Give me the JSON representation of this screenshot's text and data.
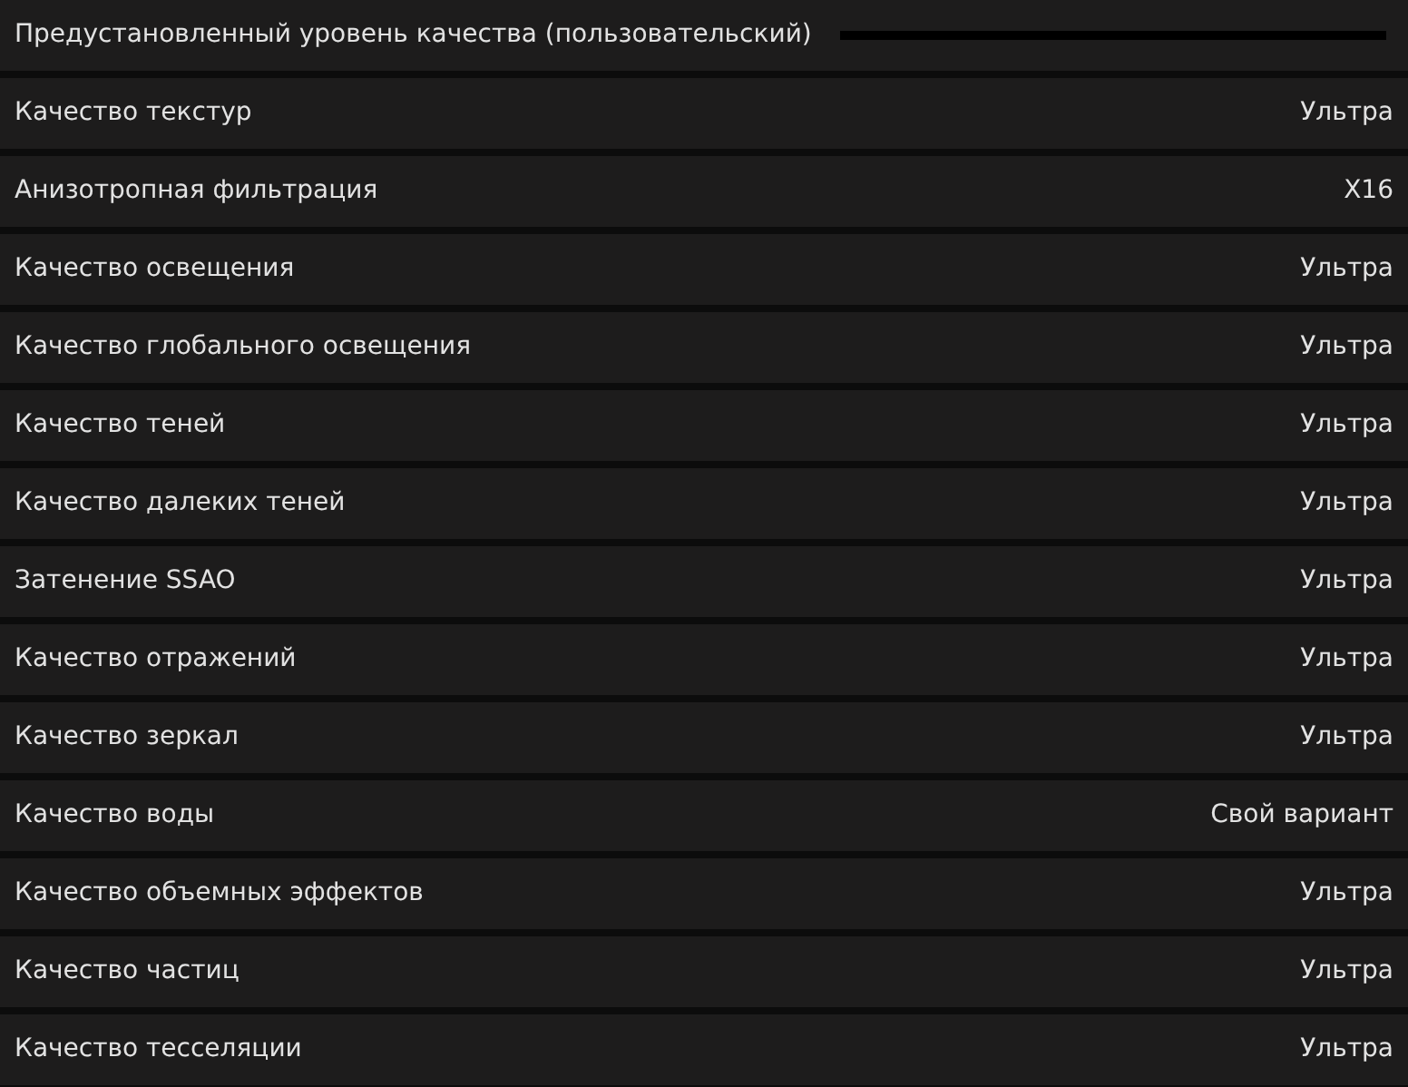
{
  "preset": {
    "label": "Предустановленный уровень качества (пользовательский)"
  },
  "settings": [
    {
      "label": "Качество текстур",
      "value": "Ультра"
    },
    {
      "label": "Анизотропная фильтрация",
      "value": "X16"
    },
    {
      "label": "Качество освещения",
      "value": "Ультра"
    },
    {
      "label": "Качество глобального освещения",
      "value": "Ультра"
    },
    {
      "label": "Качество теней",
      "value": "Ультра"
    },
    {
      "label": "Качество далеких теней",
      "value": "Ультра"
    },
    {
      "label": "Затенение SSAO",
      "value": "Ультра"
    },
    {
      "label": "Качество отражений",
      "value": "Ультра"
    },
    {
      "label": "Качество зеркал",
      "value": "Ультра"
    },
    {
      "label": "Качество воды",
      "value": "Свой вариант"
    },
    {
      "label": "Качество объемных эффектов",
      "value": "Ультра"
    },
    {
      "label": "Качество частиц",
      "value": "Ультра"
    },
    {
      "label": "Качество тесселяции",
      "value": "Ультра"
    }
  ]
}
